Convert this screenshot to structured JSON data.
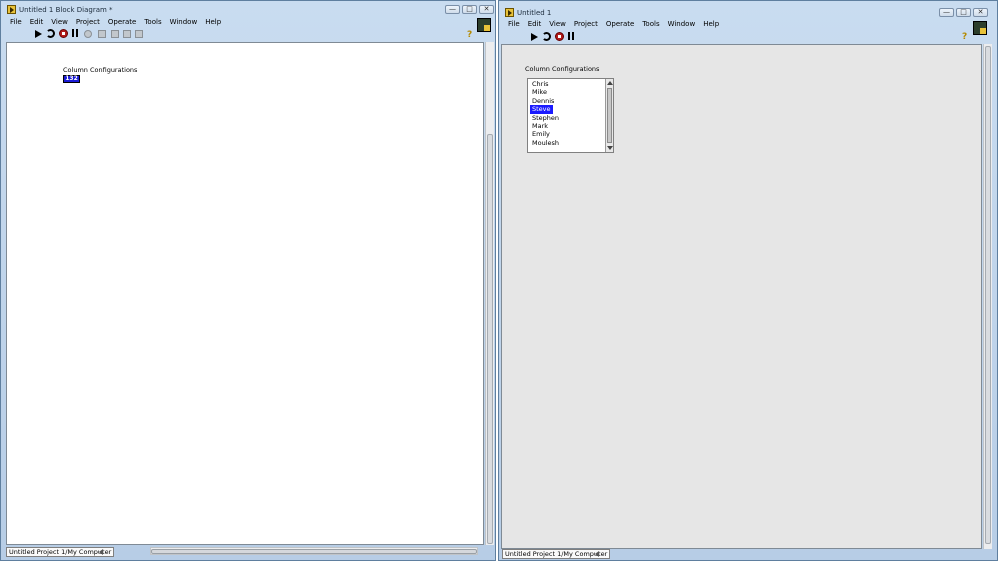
{
  "block_diagram": {
    "title": "Untitled 1 Block Diagram *",
    "window_controls": [
      "—",
      "□",
      "✕"
    ],
    "menu": [
      "File",
      "Edit",
      "View",
      "Project",
      "Operate",
      "Tools",
      "Window",
      "Help"
    ],
    "terminal_label": "Column Configurations",
    "terminal_text": "132",
    "status": "Untitled Project 1/My Computer"
  },
  "front_panel": {
    "title": "Untitled 1",
    "window_controls": [
      "—",
      "□",
      "✕"
    ],
    "menu": [
      "File",
      "Edit",
      "View",
      "Project",
      "Operate",
      "Tools",
      "Window",
      "Help"
    ],
    "listbox_label": "Column Configurations",
    "list_items": [
      "Chris",
      "Mike",
      "Dennis",
      "Steve",
      "Stephen",
      "Mark",
      "Emily",
      "Moulesh"
    ],
    "selected_item": "Steve",
    "status": "Untitled Project 1/My Computer"
  },
  "colors": {
    "selection": "#1a1aff",
    "abort": "#b21b1b"
  },
  "icons": {
    "run": "run-arrow-icon",
    "run_continuously": "run-continuously-icon",
    "abort": "abort-icon",
    "pause": "pause-icon",
    "help": "context-help-icon"
  }
}
